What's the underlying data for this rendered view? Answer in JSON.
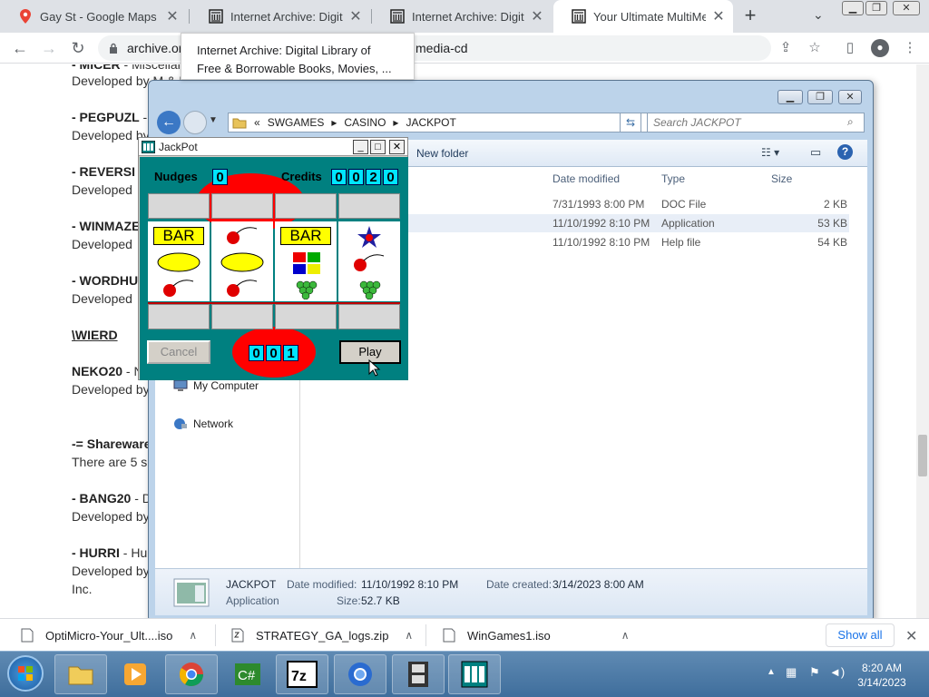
{
  "browser": {
    "tabs": [
      {
        "title": "Gay St - Google Maps",
        "icon": "maps-pin-icon"
      },
      {
        "title": "Internet Archive: Digital L",
        "icon": "archive-icon"
      },
      {
        "title": "Internet Archive: Digital L",
        "icon": "archive-icon"
      },
      {
        "title": "Your Ultimate MultiMedia",
        "icon": "archive-icon",
        "active": true
      }
    ],
    "url_left": "archive.or",
    "url_right": "media-cd",
    "tooltip_line1": "Internet Archive: Digital Library of",
    "tooltip_line2": "Free & Borrowable Books, Movies, ..."
  },
  "page": {
    "lines": [
      {
        "bold": "- MICER",
        "rest": " - Miscellanea"
      },
      {
        "bold": "",
        "rest": "Developed by M & I"
      },
      {
        "bold": "- PEGPUZL",
        "rest": " -"
      },
      {
        "bold": "",
        "rest": "Developed by"
      },
      {
        "bold": "- REVERSI",
        "rest": ""
      },
      {
        "bold": "",
        "rest": "Developed"
      },
      {
        "bold": "- WINMAZE",
        "rest": ""
      },
      {
        "bold": "",
        "rest": "Developed"
      },
      {
        "bold": "- WORDHU",
        "rest": ""
      },
      {
        "bold": "",
        "rest": "Developed"
      },
      {
        "bold": "\\WIERD",
        "rest": ""
      },
      {
        "bold": "NEKO20",
        "rest": " - N"
      },
      {
        "bold": "",
        "rest": "Developed by"
      },
      {
        "bold": "-= Shareware",
        "rest": ""
      },
      {
        "bold": "",
        "rest": "There are 5 s"
      },
      {
        "bold": "- BANG20",
        "rest": " - D"
      },
      {
        "bold": "",
        "rest": "Developed by"
      },
      {
        "bold": "- HURRI",
        "rest": " - Hu"
      },
      {
        "bold": "",
        "rest": "Developed by"
      },
      {
        "bold": "",
        "rest": "Inc."
      }
    ]
  },
  "explorer": {
    "breadcrumb": [
      "«",
      "SWGAMES",
      "▸",
      "CASINO",
      "▸",
      "JACKPOT"
    ],
    "search_placeholder": "Search JACKPOT",
    "new_folder": "New folder",
    "columns": {
      "date": "Date modified",
      "type": "Type",
      "size": "Size"
    },
    "files": [
      {
        "date": "7/31/1993 8:00 PM",
        "type": "DOC File",
        "size": "2 KB"
      },
      {
        "date": "11/10/1992 8:10 PM",
        "type": "Application",
        "size": "53 KB"
      },
      {
        "date": "11/10/1992 8:10 PM",
        "type": "Help file",
        "size": "54 KB"
      }
    ],
    "nav": {
      "computer": "My Computer",
      "network": "Network"
    },
    "details": {
      "name": "JACKPOT",
      "kind": "Application",
      "date_modified_label": "Date modified:",
      "date_modified": "11/10/1992 8:10 PM",
      "date_created_label": "Date created:",
      "date_created": "3/14/2023 8:00 AM",
      "size_label": "Size:",
      "size": "52.7 KB"
    }
  },
  "jackpot": {
    "title": "JackPot",
    "nudges_label": "Nudges",
    "nudges": "0",
    "credits_label": "Credits",
    "credits": [
      "0",
      "0",
      "2",
      "0"
    ],
    "bet": [
      "0",
      "0",
      "1"
    ],
    "bar_text": "BAR",
    "cancel": "Cancel",
    "play": "Play"
  },
  "downloads": {
    "items": [
      "OptiMicro-Your_Ult....iso",
      "STRATEGY_GA_logs.zip",
      "WinGames1.iso"
    ],
    "show_all": "Show all"
  },
  "taskbar": {
    "time": "8:20 AM",
    "date": "3/14/2023"
  }
}
